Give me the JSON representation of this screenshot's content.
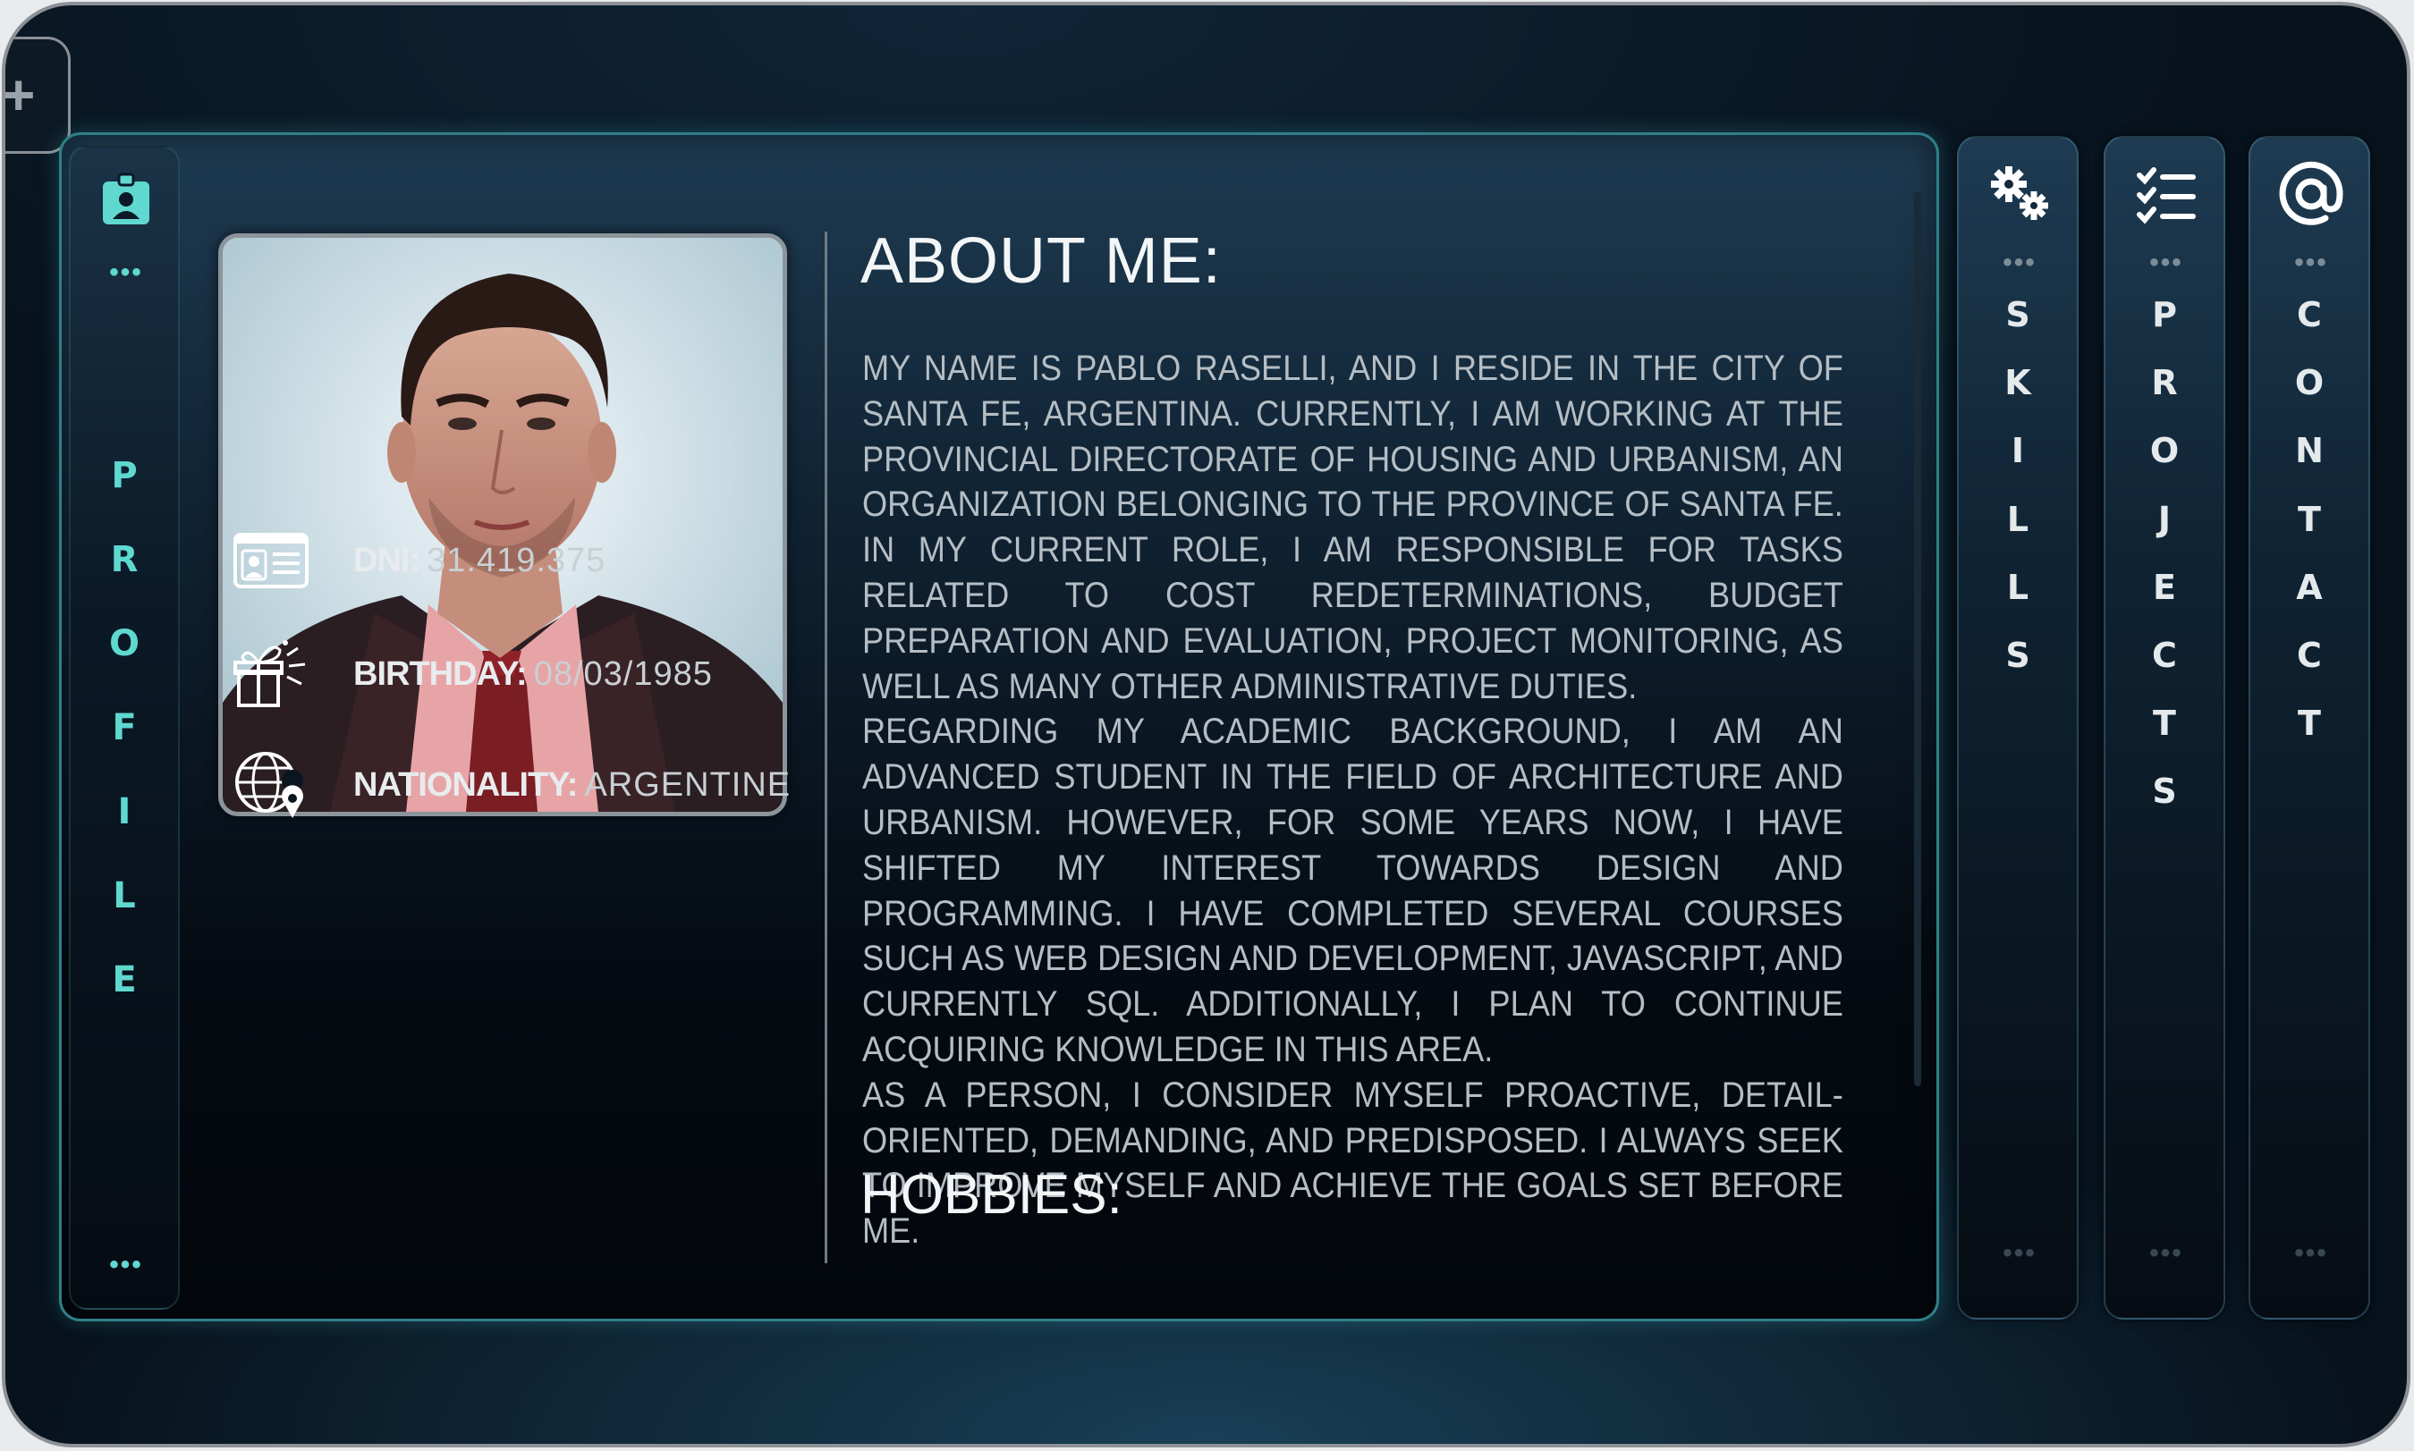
{
  "profile_tab": {
    "icon": "id-badge-icon",
    "letters": [
      "P",
      "R",
      "O",
      "F",
      "I",
      "L",
      "E"
    ]
  },
  "about": {
    "title": "ABOUT ME:",
    "paragraphs": [
      "MY NAME IS PABLO RASELLI, AND I RESIDE IN THE CITY OF SANTA FE, ARGENTINA. CURRENTLY, I AM WORKING AT THE PROVINCIAL DIRECTORATE OF HOUSING AND URBANISM, AN ORGANIZATION BELONGING TO THE PROVINCE OF SANTA FE. IN MY CURRENT ROLE, I AM RESPONSIBLE FOR TASKS RELATED TO COST REDETERMINATIONS, BUDGET PREPARATION AND EVALUATION, PROJECT MONITORING, AS WELL AS MANY OTHER ADMINISTRATIVE DUTIES.",
      "REGARDING MY ACADEMIC BACKGROUND, I AM AN ADVANCED STUDENT IN THE FIELD OF ARCHITECTURE AND URBANISM. HOWEVER, FOR SOME YEARS NOW, I HAVE SHIFTED MY INTEREST TOWARDS DESIGN AND PROGRAMMING. I HAVE COMPLETED SEVERAL COURSES SUCH AS WEB DESIGN AND DEVELOPMENT, JAVASCRIPT, AND CURRENTLY SQL. ADDITIONALLY, I PLAN TO CONTINUE ACQUIRING KNOWLEDGE IN THIS AREA.",
      "AS A PERSON, I CONSIDER MYSELF PROACTIVE, DETAIL-ORIENTED, DEMANDING, AND PREDISPOSED. I ALWAYS SEEK TO IMPROVE MYSELF AND ACHIEVE THE GOALS SET BEFORE ME."
    ]
  },
  "hobbies": {
    "title": "HOBBIES:"
  },
  "info": {
    "dni": {
      "label": "DNI:",
      "value": "31.419.375",
      "icon": "id-card-icon"
    },
    "birthday": {
      "label": "BIRTHDAY:",
      "value": "08/03/1985",
      "icon": "gift-icon"
    },
    "nationality": {
      "label": "NATIONALITY:",
      "value": "ARGENTINE",
      "icon": "globe-location-icon"
    }
  },
  "tabs": {
    "skills": {
      "icon": "gears-icon",
      "letters": [
        "S",
        "K",
        "I",
        "L",
        "L",
        "S"
      ]
    },
    "projects": {
      "icon": "checklist-icon",
      "letters": [
        "P",
        "R",
        "O",
        "J",
        "E",
        "C",
        "T",
        "S"
      ]
    },
    "contact": {
      "icon": "at-sign-icon",
      "letters": [
        "C",
        "O",
        "N",
        "T",
        "A",
        "C",
        "T"
      ]
    }
  },
  "colors": {
    "accent": "#5fd8d0",
    "card_border": "#2f7f88",
    "text": "#b5bec4"
  }
}
